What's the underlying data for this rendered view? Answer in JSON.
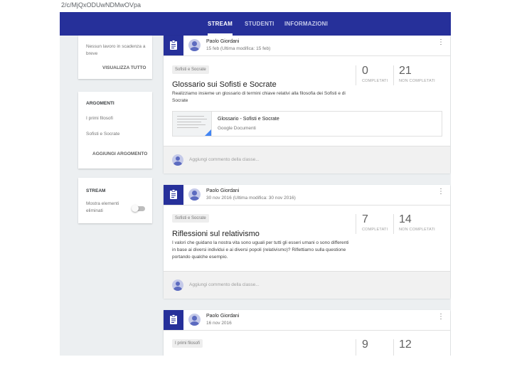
{
  "browser": {
    "url_fragment": "2/c/MjQxODUwNDMwOVpa"
  },
  "colors": {
    "accent": "#26309a",
    "background": "#eceff1"
  },
  "nav": {
    "tabs": [
      {
        "label": "STREAM",
        "active": true
      },
      {
        "label": "STUDENTI",
        "active": false
      },
      {
        "label": "INFORMAZIONI",
        "active": false
      }
    ]
  },
  "sidebar": {
    "upcoming": {
      "text": "Nessun lavoro in scadenza a breve",
      "action": "VISUALIZZA TUTTO"
    },
    "topics": {
      "heading": "ARGOMENTI",
      "items": [
        "I primi filosofi",
        "Sofisti e Socrate"
      ],
      "action": "AGGIUNGI ARGOMENTO"
    },
    "stream_settings": {
      "heading": "STREAM",
      "option": "Mostra elementi eliminati",
      "toggle_on": false
    }
  },
  "posts": [
    {
      "author": "Paolo Giordani",
      "date": "15 feb (Ultima modifica: 15 feb)",
      "topic": "Sofisti e Socrate",
      "title": "Glossario sui Sofisti e Socrate",
      "description": "Realizziamo insieme un glossario di termini chiave relativi alla filosofia dei Sofisti e di Socrate",
      "completed": "0",
      "completed_label": "COMPLETATI",
      "not_completed": "21",
      "not_completed_label": "NON COMPLETATI",
      "attachment": {
        "title": "Glossario - Sofisti e Socrate",
        "type": "Google Documenti"
      },
      "comment_placeholder": "Aggiungi commento della classe..."
    },
    {
      "author": "Paolo Giordani",
      "date": "30 nov 2016 (Ultima modifica: 30 nov 2016)",
      "topic": "Sofisti e Socrate",
      "title": "Riflessioni sul relativismo",
      "description": "I valori che guidano la nostra vita sono uguali per tutti gli esseri umani o sono differenti in base ai diversi individui e ai diversi popoli (relativismo)? Riflettiamo sulla questione portando qualche esempio.",
      "completed": "7",
      "completed_label": "COMPLETATI",
      "not_completed": "14",
      "not_completed_label": "NON COMPLETATI",
      "comment_placeholder": "Aggiungi commento della classe..."
    },
    {
      "author": "Paolo Giordani",
      "date": "16 nov 2016",
      "topic": "I primi filosofi",
      "completed": "9",
      "not_completed": "12"
    }
  ]
}
